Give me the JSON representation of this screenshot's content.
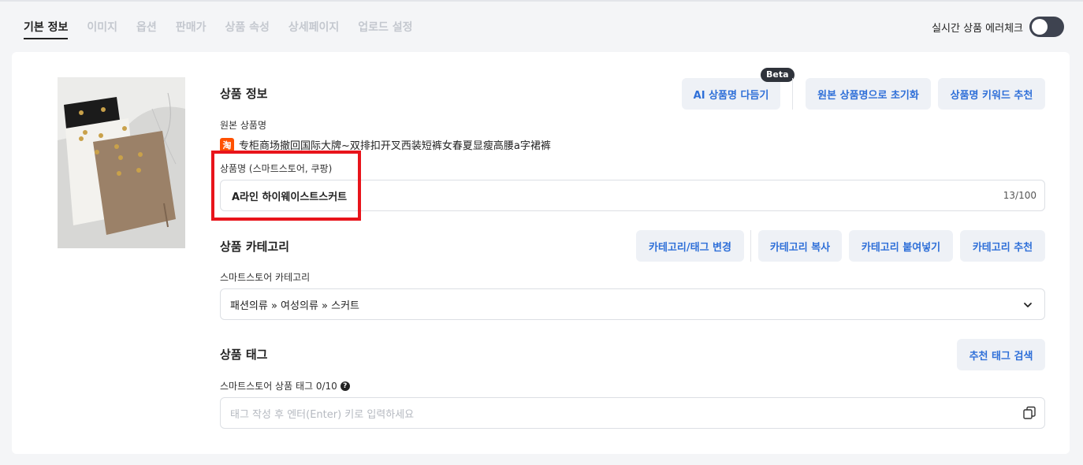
{
  "tabs": [
    "기본 정보",
    "이미지",
    "옵션",
    "판매가",
    "상품 속성",
    "상세페이지",
    "업로드 설정"
  ],
  "live_check": {
    "label": "실시간 상품 에러체크"
  },
  "product_info": {
    "title": "상품 정보",
    "ai_button": "AI 상품명 다듬기",
    "beta_badge": "Beta",
    "reset_button": "원본 상품명으로 초기화",
    "keyword_button": "상품명 키워드 추천",
    "original_label": "원본 상품명",
    "taobao_icon_char": "淘",
    "original_name": "专柜商场撤回国际大牌~双排扣开叉西装短裤女春夏显瘦高腰a字裙裤",
    "name_label": "상품명 (스마트스토어, 쿠팡)",
    "name_value": "A라인 하이웨이스트스커트",
    "name_counter": "13/100"
  },
  "category": {
    "title": "상품 카테고리",
    "change_button": "카테고리/태그 변경",
    "copy_button": "카테고리 복사",
    "paste_button": "카테고리 붙여넣기",
    "recommend_button": "카테고리 추천",
    "label": "스마트스토어 카테고리",
    "selected": "패션의류 » 여성의류 » 스커트"
  },
  "tags": {
    "title": "상품 태그",
    "search_button": "추천 태그 검색",
    "label": "스마트스토어 상품 태그 0/10",
    "help_char": "?",
    "placeholder": "태그 작성 후 엔터(Enter) 키로 입력하세요"
  },
  "colors": {
    "accent": "#2e6fd8",
    "highlight": "#e8141b",
    "toggle": "#3e4350"
  }
}
